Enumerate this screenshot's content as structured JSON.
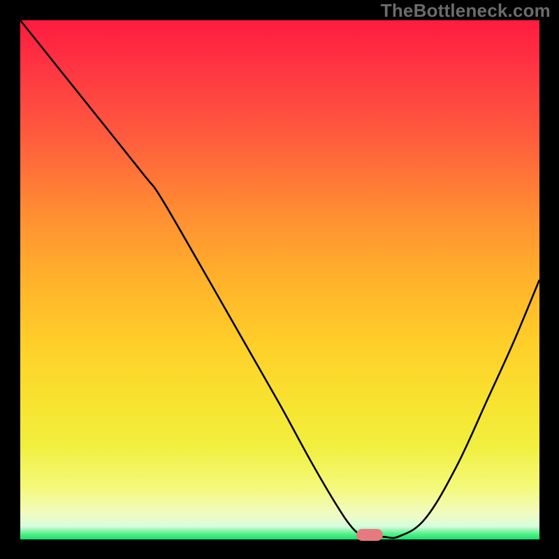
{
  "watermark": "TheBottleneck.com",
  "marker": {
    "x_pct": 67.3,
    "y_pct": 99.1,
    "color": "#e77a7e"
  },
  "chart_data": {
    "type": "line",
    "title": "",
    "xlabel": "",
    "ylabel": "",
    "xlim": [
      0,
      100
    ],
    "ylim": [
      0,
      100
    ],
    "grid": false,
    "series": [
      {
        "name": "curve",
        "x": [
          0,
          8,
          16,
          24,
          27,
          34,
          42,
          50,
          56,
          61,
          64,
          66,
          70,
          73,
          78,
          84,
          90,
          95,
          100
        ],
        "y": [
          100,
          90,
          80,
          70,
          66,
          54,
          40,
          26,
          15,
          6.5,
          2.2,
          0.9,
          0.5,
          0.6,
          4,
          14,
          27,
          38,
          50
        ]
      }
    ],
    "background_gradient": {
      "top_color": "#ff1b3f",
      "mid_color": "#ffce29",
      "bottom_color": "#17e06e"
    },
    "marker_point": {
      "x": 67.3,
      "y": 0.9
    }
  }
}
